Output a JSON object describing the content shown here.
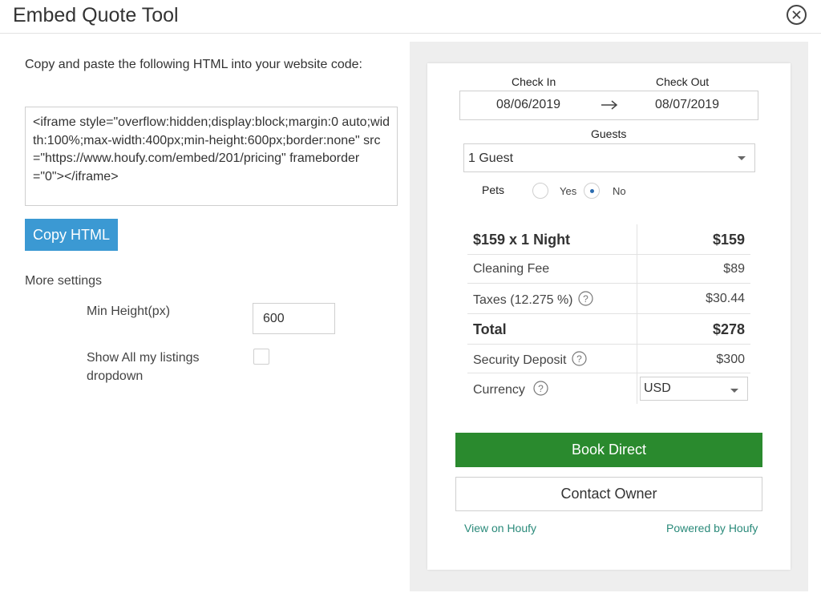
{
  "header": {
    "title": "Embed Quote Tool",
    "close_icon": "close-circle-icon"
  },
  "left": {
    "instructions": "Copy and paste the following HTML into your website code:",
    "embed_code": "<iframe style=\"overflow:hidden;display:block;margin:0 auto;width:100%;max-width:400px;min-height:600px;border:none\" src=\"https://www.houfy.com/embed/201/pricing\" frameborder=\"0\"></iframe>",
    "copy_button": "Copy HTML",
    "more_settings": "More settings",
    "min_height_label": "Min Height(px)",
    "min_height_value": "600",
    "show_listings_label": "Show All my listings dropdown",
    "show_listings_checked": false
  },
  "widget": {
    "check_in_label": "Check In",
    "check_out_label": "Check Out",
    "check_in_value": "08/06/2019",
    "check_out_value": "08/07/2019",
    "guests_label": "Guests",
    "guests_value": "1 Guest",
    "pets_label": "Pets",
    "pets_yes": "Yes",
    "pets_no": "No",
    "pets_selected": "No",
    "price_rows": [
      {
        "label": "$159 x 1 Night",
        "value": "$159",
        "bold": true
      },
      {
        "label": "Cleaning Fee",
        "value": "$89",
        "bold": false
      },
      {
        "label": "Taxes (12.275 %)",
        "value": "$30.44",
        "bold": false,
        "help": true
      },
      {
        "label": "Total",
        "value": "$278",
        "bold": true
      },
      {
        "label": "Security Deposit",
        "value": "$300",
        "bold": false,
        "help": true
      }
    ],
    "currency_label": "Currency",
    "currency_value": "USD",
    "book_button": "Book Direct",
    "contact_button": "Contact Owner",
    "view_link": "View on Houfy",
    "powered_link": "Powered by Houfy"
  },
  "colors": {
    "copy_button": "#3b99d3",
    "book_button": "#2a8a2e",
    "link": "#2a8a7a",
    "preview_bg": "#eeeeee"
  }
}
